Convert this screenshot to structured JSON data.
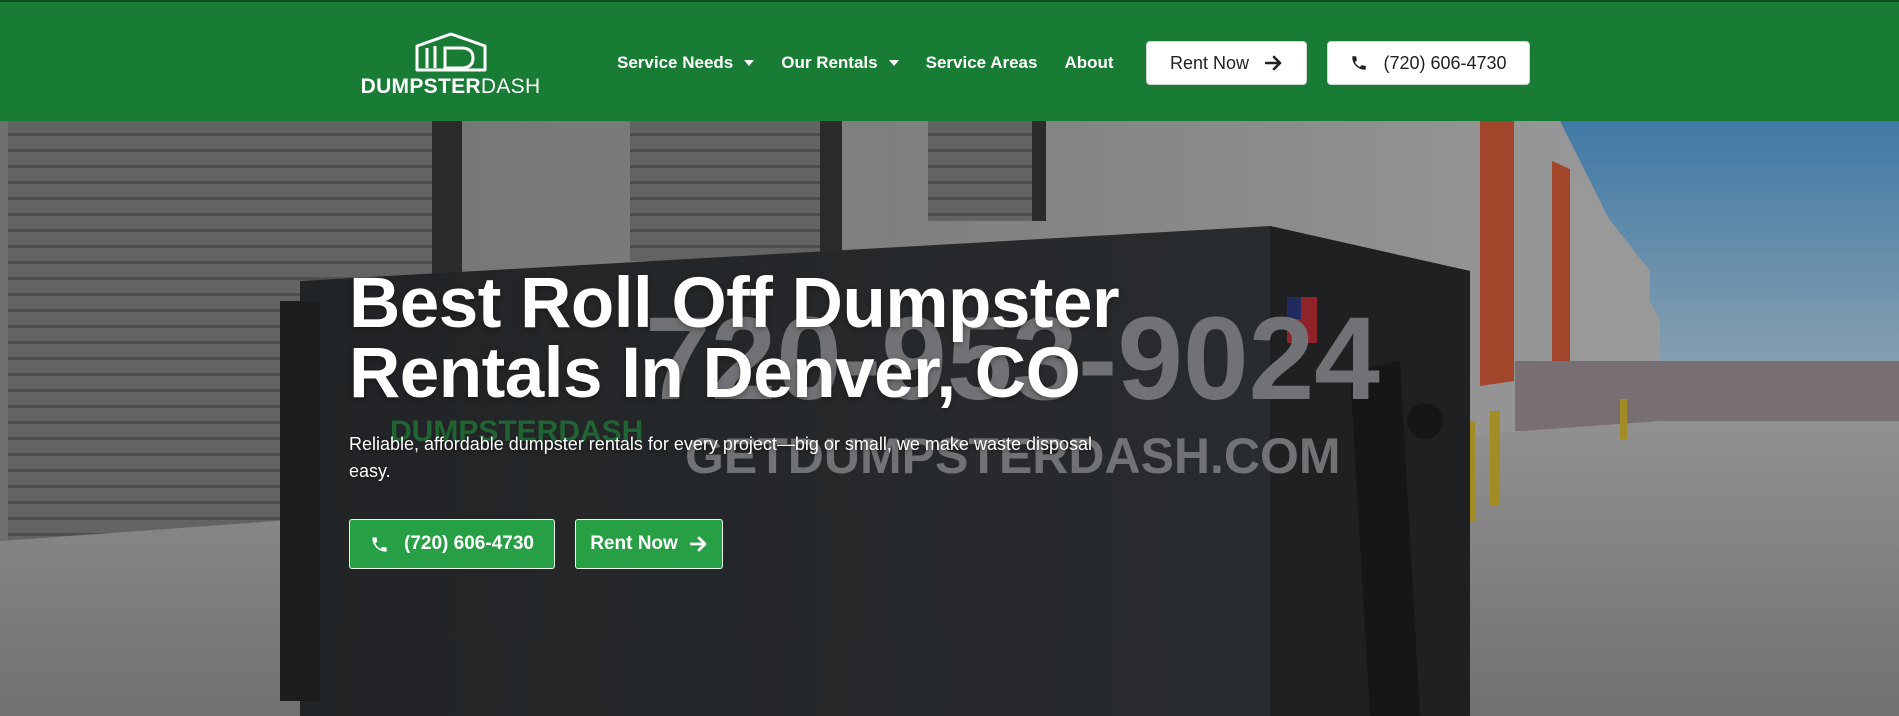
{
  "header": {
    "logo": {
      "text_bold": "DUMPSTER",
      "text_light": "DASH",
      "icon": "dumpster-logo-icon"
    },
    "nav": [
      {
        "label": "Service Needs",
        "has_dropdown": true
      },
      {
        "label": "Our Rentals",
        "has_dropdown": true
      },
      {
        "label": "Service Areas",
        "has_dropdown": false
      },
      {
        "label": "About",
        "has_dropdown": false
      }
    ],
    "rent_button": {
      "label": "Rent Now",
      "icon": "arrow-right-icon"
    },
    "phone_button": {
      "label": "(720) 606-4730",
      "icon": "phone-icon"
    }
  },
  "hero": {
    "title_line1": "Best Roll Off Dumpster",
    "title_line2": "Rentals In Denver, CO",
    "subtitle": "Reliable, affordable dumpster rentals for every project—big or small, we make waste disposal easy.",
    "phone_button": {
      "label": "(720) 606-4730",
      "icon": "phone-icon"
    },
    "rent_button": {
      "label": "Rent Now",
      "icon": "arrow-right-icon"
    },
    "background_print": {
      "phone": "720-953-9024",
      "website": "GETDUMPSTERDASH.COM",
      "brand": "DUMPSTERDASH"
    }
  },
  "colors": {
    "brand_green": "#187c35",
    "cta_green": "#27a045",
    "white": "#ffffff"
  }
}
